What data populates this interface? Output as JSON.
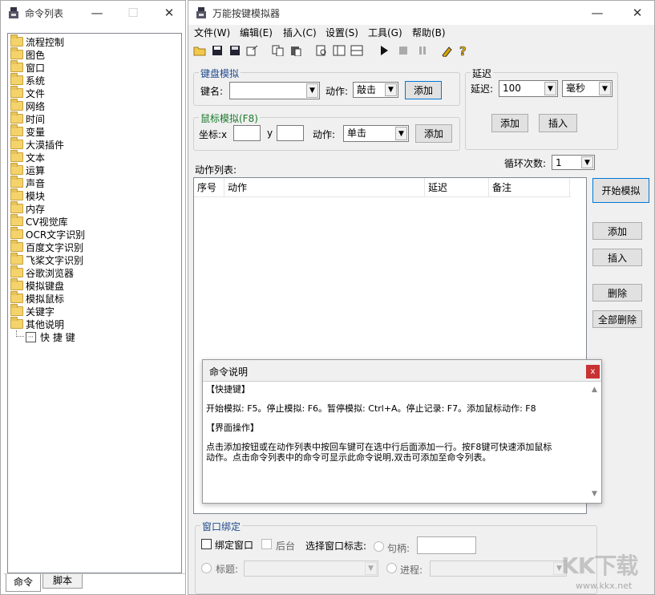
{
  "left_window": {
    "title": "命令列表",
    "tree": [
      "流程控制",
      "图色",
      "窗口",
      "系统",
      "文件",
      "网络",
      "时间",
      "变量",
      "大漠插件",
      "文本",
      "运算",
      "声音",
      "模块",
      "内存",
      "CV视觉库",
      "OCR文字识别",
      "百度文字识别",
      "飞桨文字识别",
      "谷歌浏览器",
      "模拟键盘",
      "模拟鼠标",
      "关键字",
      "其他说明"
    ],
    "tree_child": "快 捷 键",
    "tabs": [
      "命令",
      "脚本"
    ]
  },
  "main_window": {
    "title": "万能按键模拟器",
    "menu": [
      "文件(W)",
      "编辑(E)",
      "插入(C)",
      "设置(S)",
      "工具(G)",
      "帮助(B)"
    ],
    "keyboard": {
      "group_title": "键盘模拟",
      "key_label": "键名:",
      "key_value": "",
      "action_label": "动作:",
      "action_value": "敲击",
      "add_label": "添加"
    },
    "mouse": {
      "group_title": "鼠标模拟(F8)",
      "coord_label": "坐标:x",
      "y_label": "y",
      "action_label": "动作:",
      "action_value": "单击",
      "add_label": "添加"
    },
    "delay": {
      "group_title": "延迟",
      "label": "延迟:",
      "value": "100",
      "unit": "毫秒",
      "add_label": "添加",
      "insert_label": "插入"
    },
    "action_list_label": "动作列表:",
    "loop_label": "循环次数:",
    "loop_value": "1",
    "columns": [
      "序号",
      "动作",
      "延迟",
      "备注"
    ],
    "side_buttons": {
      "start": "开始模拟",
      "add": "添加",
      "insert": "插入",
      "delete": "删除",
      "delete_all": "全部删除"
    },
    "window_bind": {
      "group_title": "窗口绑定",
      "bind_label": "绑定窗口",
      "background_label": "后台",
      "select_label": "选择窗口标志:",
      "handle_label": "句柄:",
      "title_label": "标题:",
      "process_label": "进程:"
    }
  },
  "dialog": {
    "title": "命令说明",
    "close": "x",
    "h1": "【快捷键】",
    "p1": "开始模拟: F5。停止模拟: F6。暂停模拟: Ctrl+A。停止记录: F7。添加鼠标动作: F8",
    "h2": "【界面操作】",
    "p2a": "点击添加按钮或在动作列表中按回车键可在选中行后面添加一行。按F8键可快速添加鼠标",
    "p2b": "动作。点击命令列表中的命令可显示此命令说明,双击可添加至命令列表。"
  },
  "watermark": {
    "main": "KK下载",
    "sub": "www.kkx.net"
  }
}
